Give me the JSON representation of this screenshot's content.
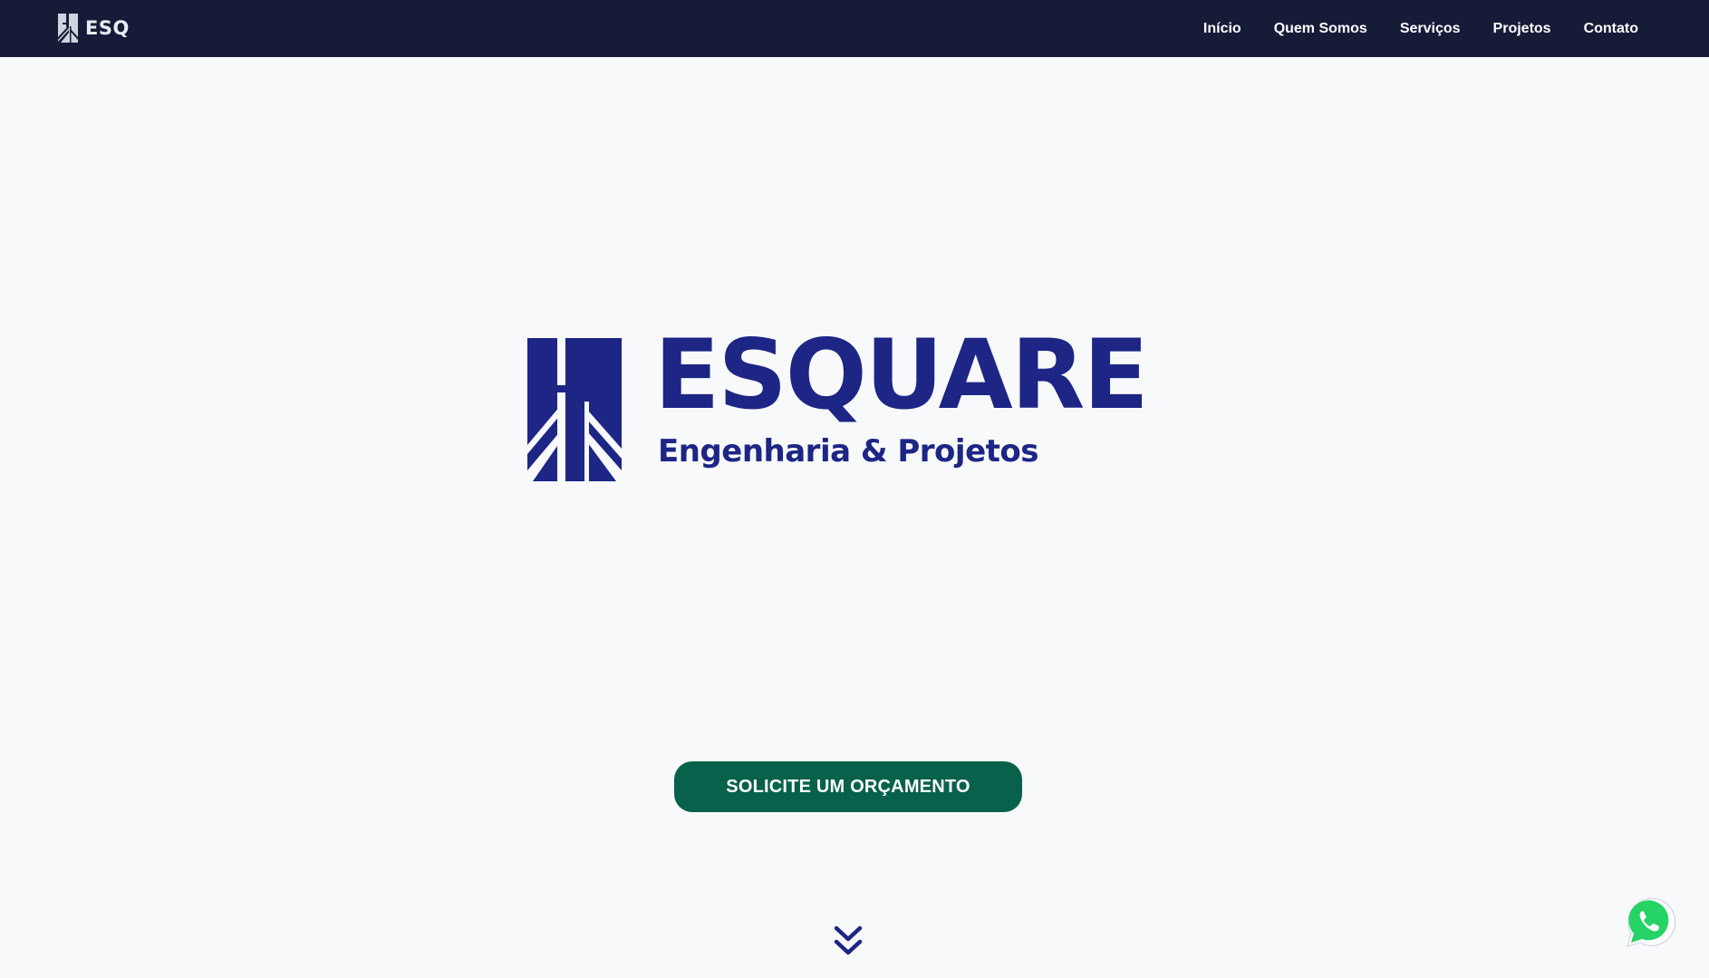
{
  "nav": {
    "brand": "ESQ",
    "links": [
      "Início",
      "Quem Somos",
      "Serviços",
      "Projetos",
      "Contato"
    ]
  },
  "hero": {
    "title": "ESQUARE",
    "subtitle": "Engenharia & Projetos",
    "cta_label": "SOLICITE UM ORÇAMENTO"
  },
  "icons": {
    "scroll": "double-chevron-down-icon",
    "whatsapp": "whatsapp-icon"
  },
  "colors": {
    "navbar_bg": "#161b38",
    "brand_blue": "#1d2585",
    "cta_green": "#07614b",
    "page_bg": "#f7f9fb",
    "whatsapp_green": "#25d366"
  }
}
